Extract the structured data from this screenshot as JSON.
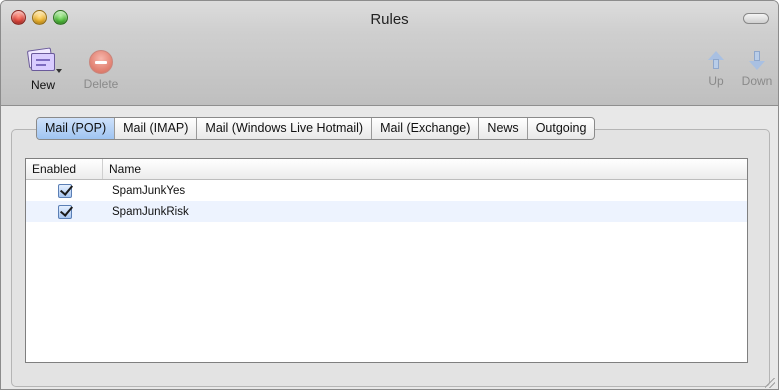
{
  "window": {
    "title": "Rules"
  },
  "toolbar": {
    "new_label": "New",
    "delete_label": "Delete",
    "up_label": "Up",
    "down_label": "Down"
  },
  "tabs": [
    {
      "label": "Mail (POP)",
      "active": true
    },
    {
      "label": "Mail (IMAP)",
      "active": false
    },
    {
      "label": "Mail (Windows Live Hotmail)",
      "active": false
    },
    {
      "label": "Mail (Exchange)",
      "active": false
    },
    {
      "label": "News",
      "active": false
    },
    {
      "label": "Outgoing",
      "active": false
    }
  ],
  "table": {
    "columns": [
      "Enabled",
      "Name"
    ],
    "rows": [
      {
        "enabled": true,
        "name": "SpamJunkYes"
      },
      {
        "enabled": true,
        "name": "SpamJunkRisk"
      }
    ]
  },
  "colors": {
    "active_tab": "#9fc4f1",
    "alt_row": "#edf3fe"
  }
}
